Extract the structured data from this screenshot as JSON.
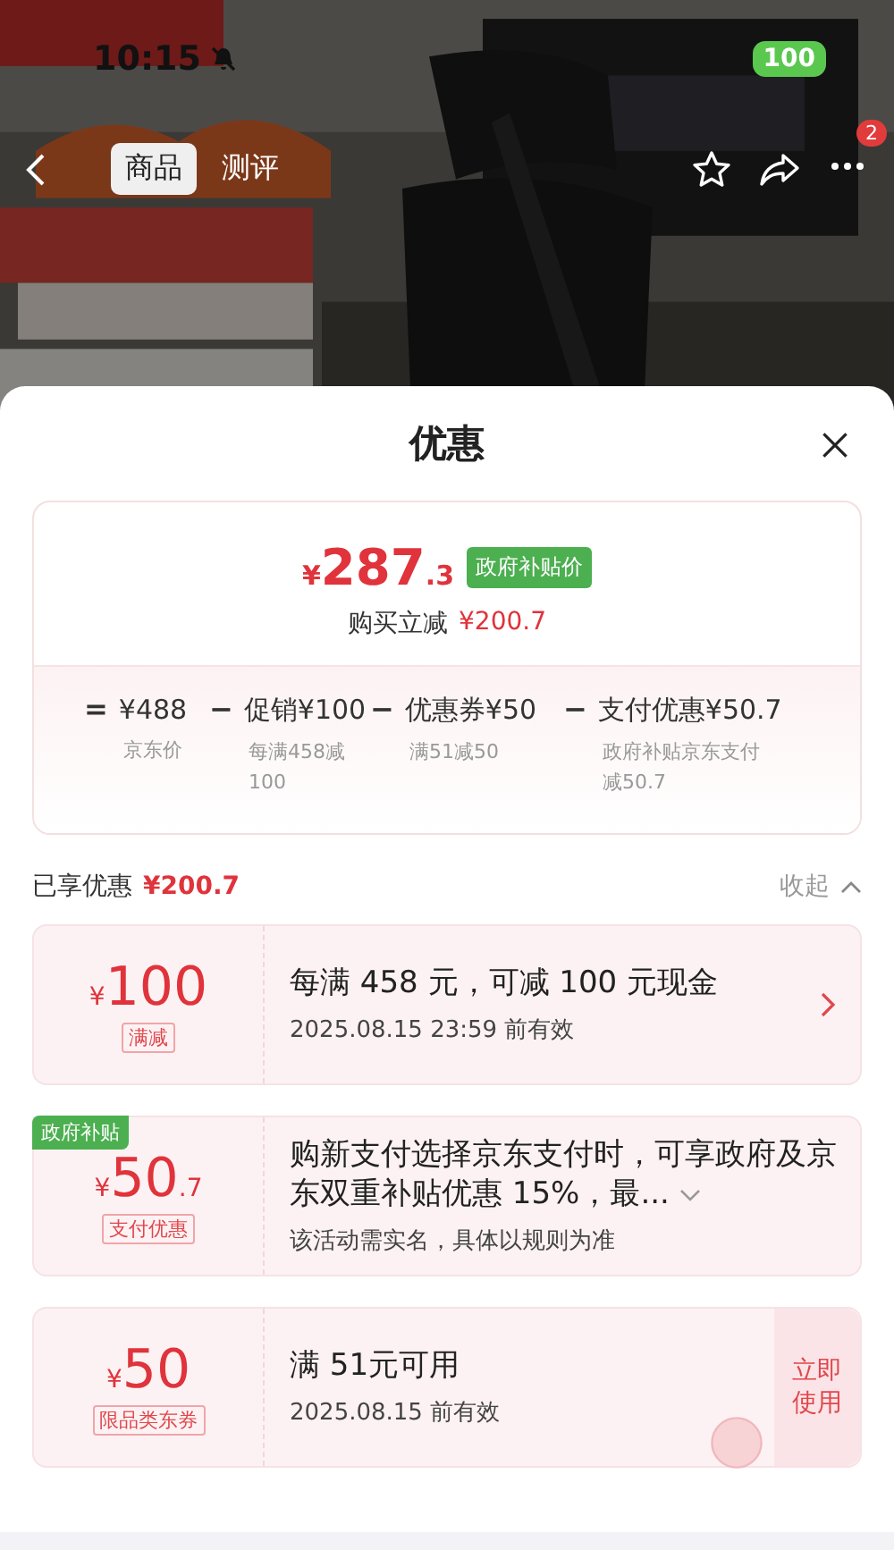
{
  "status_bar": {
    "time": "10:15",
    "battery": "100"
  },
  "nav": {
    "tabs": [
      {
        "label": "商品",
        "selected": true
      },
      {
        "label": "测评",
        "selected": false
      }
    ],
    "more_badge": "2"
  },
  "sheet": {
    "title": "优惠",
    "summary": {
      "currency": "¥",
      "price_int": "287",
      "price_dec": ".3",
      "price_tag": "政府补贴价",
      "saving_label": "购买立减",
      "saving_value": "¥200.7",
      "breakdown": [
        {
          "op": "=",
          "amount": "¥488",
          "note": "京东价"
        },
        {
          "op": "−",
          "amount": "促销¥100",
          "note": "每满458减100"
        },
        {
          "op": "−",
          "amount": "优惠券¥50",
          "note": "满51减50"
        },
        {
          "op": "−",
          "amount": "支付优惠¥50.7",
          "note": "政府补贴京东支付减50.7"
        }
      ]
    },
    "enjoyed": {
      "label": "已享优惠",
      "value": "¥200.7",
      "collapse": "收起"
    },
    "offers": [
      {
        "kind": "promo",
        "currency": "¥",
        "amount": "100",
        "tag": "满减",
        "title": "每满 458 元，可减 100 元现金",
        "subtitle": "2025.08.15 23:59 前有效"
      },
      {
        "kind": "payment",
        "corner_badge": "政府补贴",
        "currency": "¥",
        "amount": "50",
        "decimal": ".7",
        "tag": "支付优惠",
        "title": "购新支付选择京东支付时，可享政府及京东双重补贴优惠 15%，最...",
        "subtitle": "该活动需实名，具体以规则为准"
      },
      {
        "kind": "coupon",
        "currency": "¥",
        "amount": "50",
        "tag": "限品类东券",
        "title": "满 51元可用",
        "subtitle": "2025.08.15 前有效",
        "action": "立即使用"
      }
    ]
  }
}
